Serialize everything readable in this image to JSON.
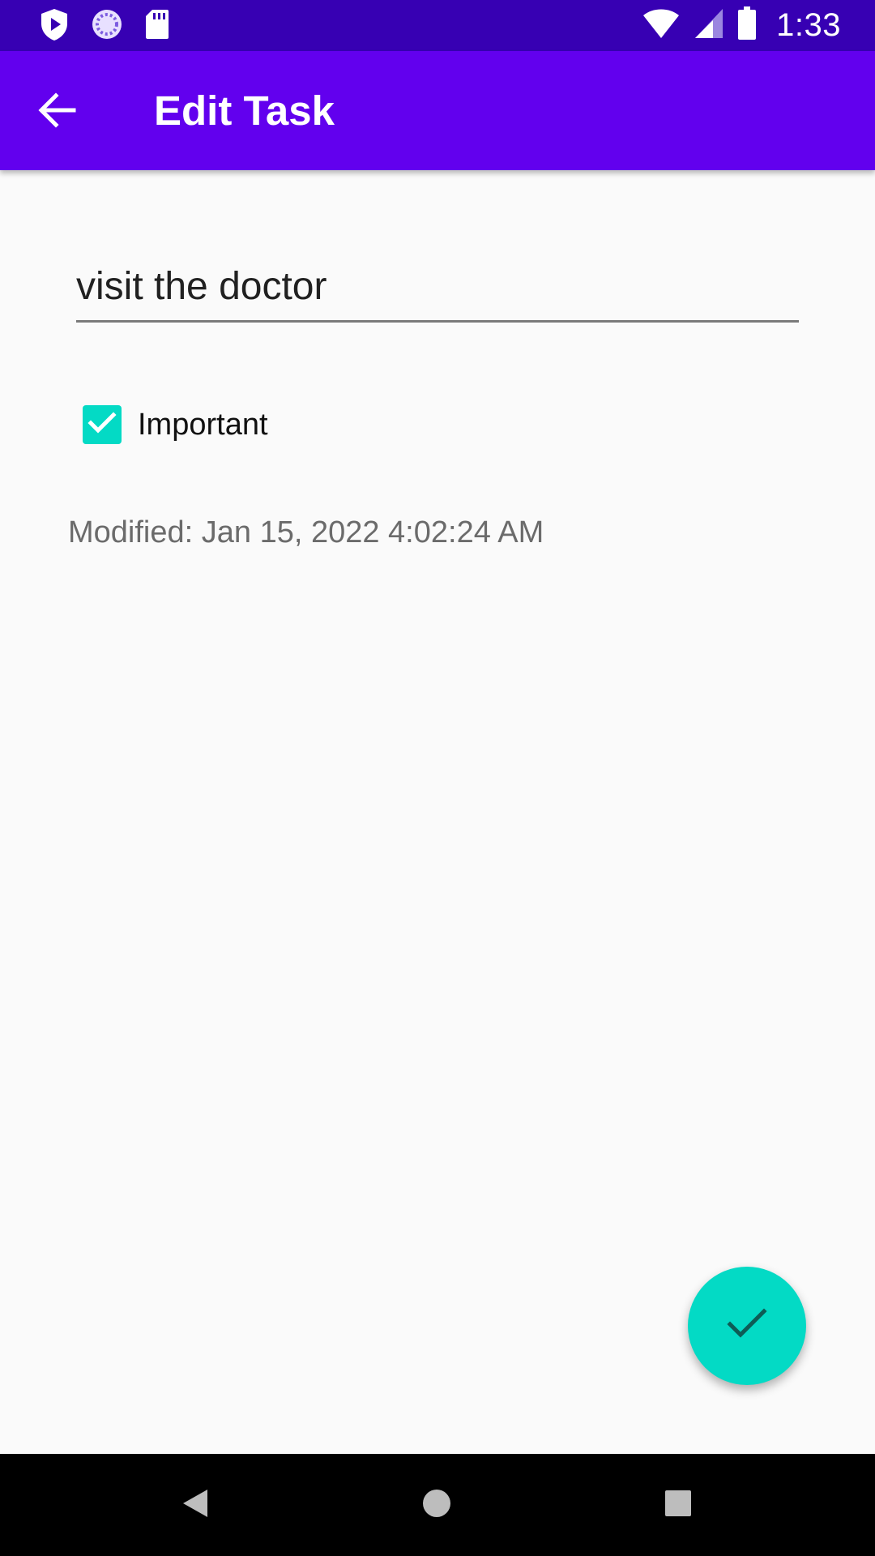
{
  "status_bar": {
    "time": "1:33",
    "left_icons": [
      "shield-play-icon",
      "sync-circle-icon",
      "sd-card-icon"
    ],
    "right_icons": [
      "wifi-icon",
      "cell-signal-icon",
      "battery-icon"
    ]
  },
  "app_bar": {
    "title": "Edit Task",
    "back_icon": "arrow-back-icon"
  },
  "form": {
    "task_text": "visit the doctor",
    "important_label": "Important",
    "important_checked": true,
    "modified_text": "Modified: Jan 15, 2022 4:02:24 AM"
  },
  "fab": {
    "icon": "check-icon"
  },
  "nav_bar": {
    "icons": [
      "back-triangle-icon",
      "home-circle-icon",
      "recents-square-icon"
    ]
  },
  "colors": {
    "status_bar": "#3700b3",
    "app_bar": "#6200ee",
    "accent": "#03dac5",
    "background": "#fafafa"
  }
}
